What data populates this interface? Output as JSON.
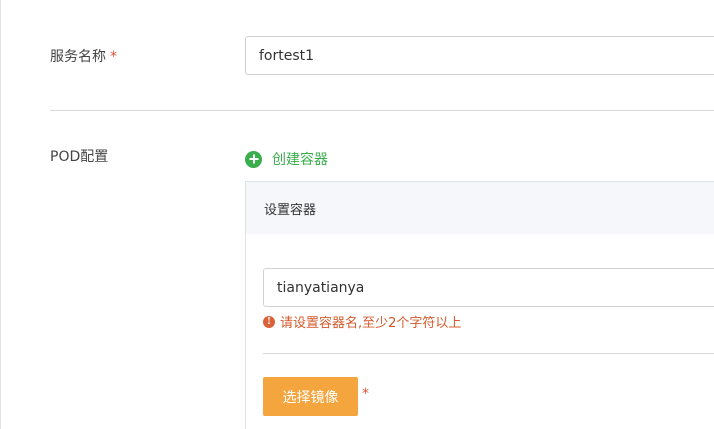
{
  "service_name": {
    "label": "服务名称",
    "required_mark": "*",
    "value": "fortest1"
  },
  "pod_config": {
    "label": "POD配置",
    "create_container_label": "创建容器",
    "panel": {
      "title": "设置容器",
      "container_name_value": "tianyatianya",
      "error_icon": "!",
      "error_text": "请设置容器名,至少2个字符以上",
      "select_image_label": "选择镜像",
      "select_image_required_mark": "*"
    }
  },
  "colors": {
    "accent_green": "#3aae4d",
    "warning_orange": "#f5a53d",
    "error_red": "#d35a2c",
    "required_red": "#e4542f"
  },
  "icons": {
    "create": "plus-circle-icon",
    "error": "info-circle-icon"
  }
}
